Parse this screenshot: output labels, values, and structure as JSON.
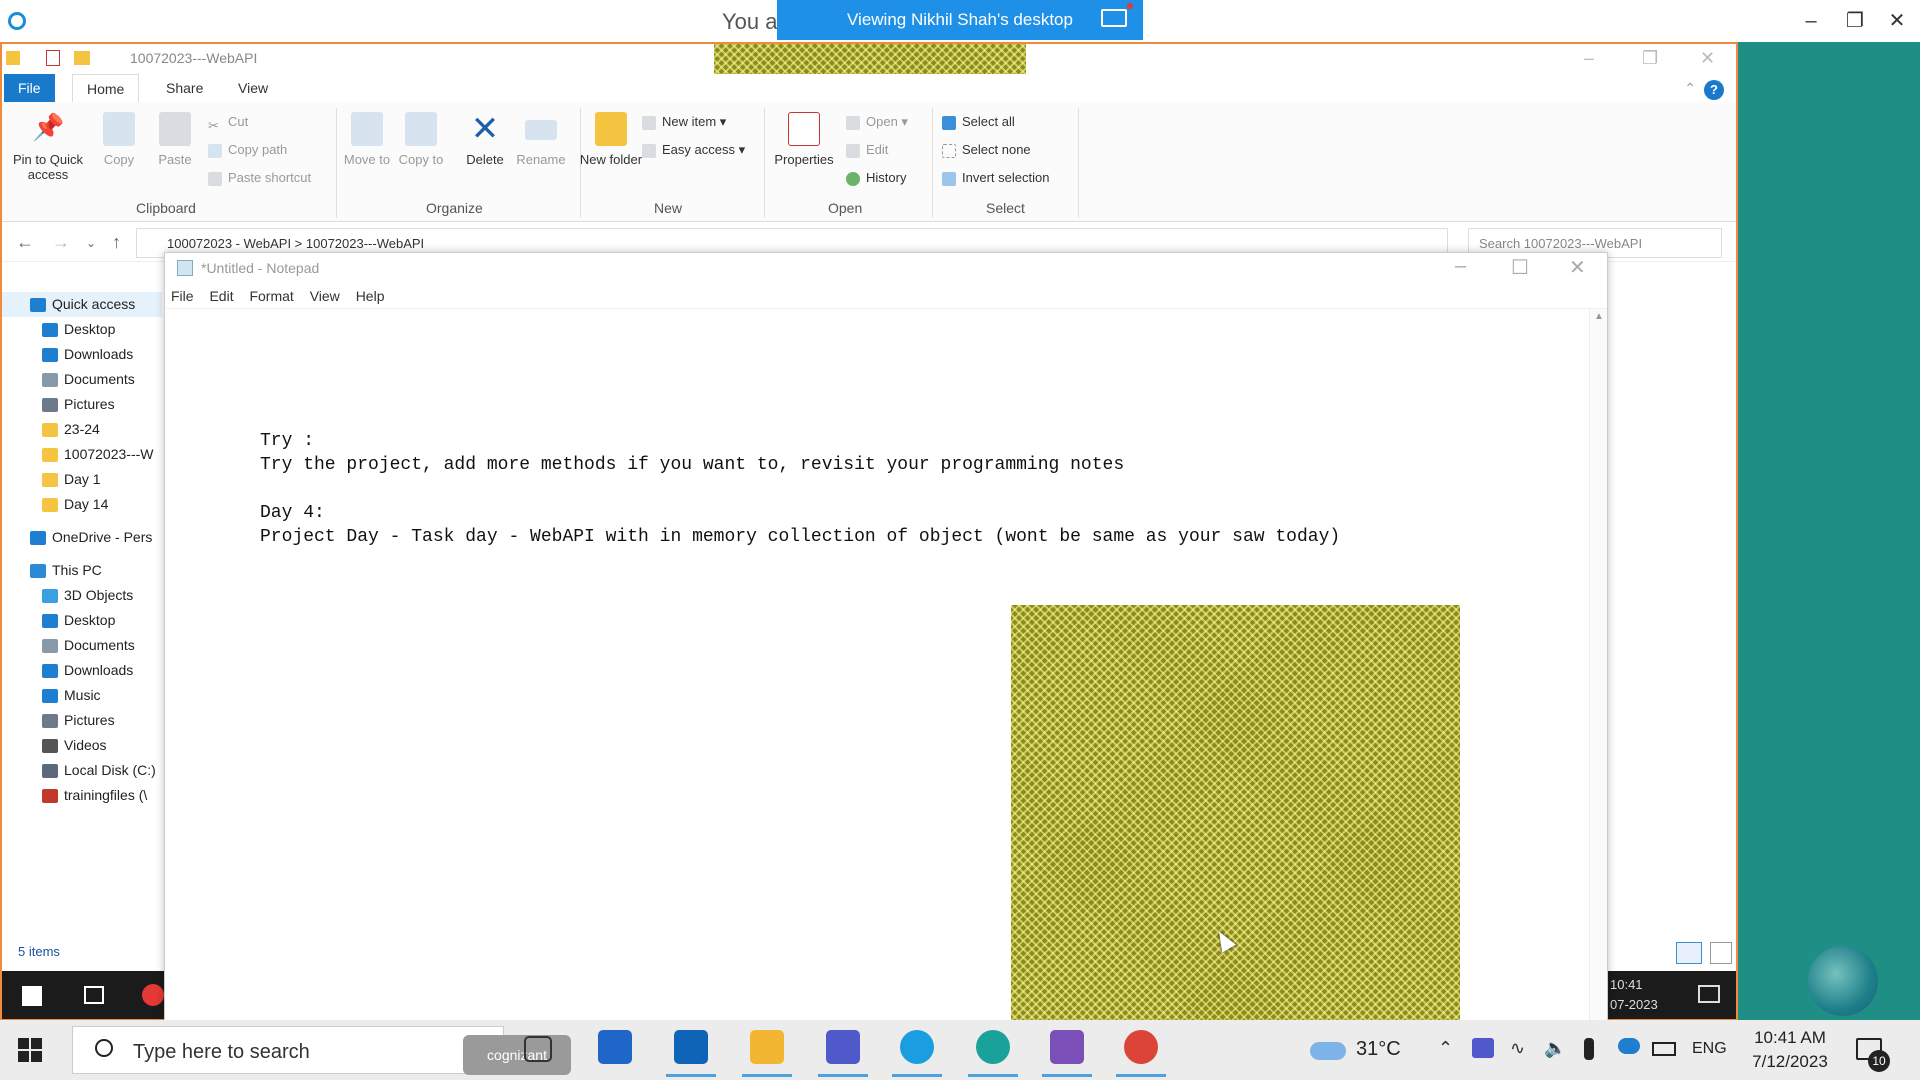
{
  "viewer": {
    "title_left": "You a",
    "banner": "Viewing Nikhil Shah's desktop"
  },
  "explorer": {
    "title": "10072023---WebAPI",
    "tabs": [
      "File",
      "Home",
      "Share",
      "View"
    ],
    "help": "?",
    "clipboard": {
      "pin_label": "Pin to Quick access",
      "copy_label": "Copy",
      "paste_label": "Paste",
      "cut_label": "Cut",
      "copy_path_label": "Copy path",
      "paste_shortcut_label": "Paste shortcut",
      "group_label": "Clipboard"
    },
    "organize": {
      "move_label": "Move to",
      "copy_to_label": "Copy to",
      "delete_label": "Delete",
      "rename_label": "Rename",
      "group_label": "Organize"
    },
    "new": {
      "new_folder_label": "New folder",
      "new_item_label": "New item",
      "easy_access_label": "Easy access",
      "group_label": "New"
    },
    "open": {
      "properties_label": "Properties",
      "open_label": "Open",
      "edit_label": "Edit",
      "history_label": "History",
      "group_label": "Open"
    },
    "select": {
      "select_all_label": "Select all",
      "select_none_label": "Select none",
      "invert_label": "Invert selection",
      "group_label": "Select"
    },
    "address": "100072023 - WebAPI  >  10072023---WebAPI",
    "search_placeholder": "Search 10072023---WebAPI",
    "sidebar": [
      {
        "label": "Quick access",
        "icon": "star-icon",
        "color": "#1e7fd0"
      },
      {
        "label": "Desktop",
        "icon": "desktop-icon",
        "color": "#1e7fd0"
      },
      {
        "label": "Downloads",
        "icon": "download-icon",
        "color": "#1e7fd0"
      },
      {
        "label": "Documents",
        "icon": "document-icon",
        "color": "#8899aa"
      },
      {
        "label": "Pictures",
        "icon": "pictures-icon",
        "color": "#6c7a8a"
      },
      {
        "label": "23-24",
        "icon": "folder-icon",
        "color": "#f5c542"
      },
      {
        "label": "10072023---W",
        "icon": "folder-icon",
        "color": "#f5c542"
      },
      {
        "label": "Day 1",
        "icon": "folder-icon",
        "color": "#f5c542"
      },
      {
        "label": "Day 14",
        "icon": "folder-icon",
        "color": "#f5c542"
      },
      {
        "label": "OneDrive - Pers",
        "icon": "onedrive-icon",
        "color": "#1e7fd0"
      },
      {
        "label": "This PC",
        "icon": "pc-icon",
        "color": "#2a8ad6"
      },
      {
        "label": "3D Objects",
        "icon": "3d-objects-icon",
        "color": "#3aa0e0"
      },
      {
        "label": "Desktop",
        "icon": "desktop-icon",
        "color": "#1e7fd0"
      },
      {
        "label": "Documents",
        "icon": "document-icon",
        "color": "#8899aa"
      },
      {
        "label": "Downloads",
        "icon": "download-icon",
        "color": "#1e7fd0"
      },
      {
        "label": "Music",
        "icon": "music-icon",
        "color": "#1e7fd0"
      },
      {
        "label": "Pictures",
        "icon": "pictures-icon",
        "color": "#6c7a8a"
      },
      {
        "label": "Videos",
        "icon": "videos-icon",
        "color": "#555555"
      },
      {
        "label": "Local Disk (C:)",
        "icon": "disk-icon",
        "color": "#5a6a7a"
      },
      {
        "label": "trainingfiles (\\",
        "icon": "network-drive-icon",
        "color": "#c0392b"
      }
    ],
    "status": "5 items"
  },
  "notepad": {
    "title": "*Untitled - Notepad",
    "menu": [
      "File",
      "Edit",
      "Format",
      "View",
      "Help"
    ],
    "lines": [
      "Try :",
      "Try the project, add more methods if you want to, revisit your programming notes",
      "",
      "Day 4:",
      "Project Day - Task day - WebAPI with in memory collection of object (wont be same as your saw today)"
    ]
  },
  "remote_clock": {
    "time": "10:41",
    "date": "07-2023"
  },
  "taskbar": {
    "search_placeholder": "Type here to search",
    "cognizant": "cognizant",
    "temperature": "31°C",
    "language": "ENG",
    "time": "10:41 AM",
    "date": "7/12/2023",
    "notifications": "10"
  }
}
